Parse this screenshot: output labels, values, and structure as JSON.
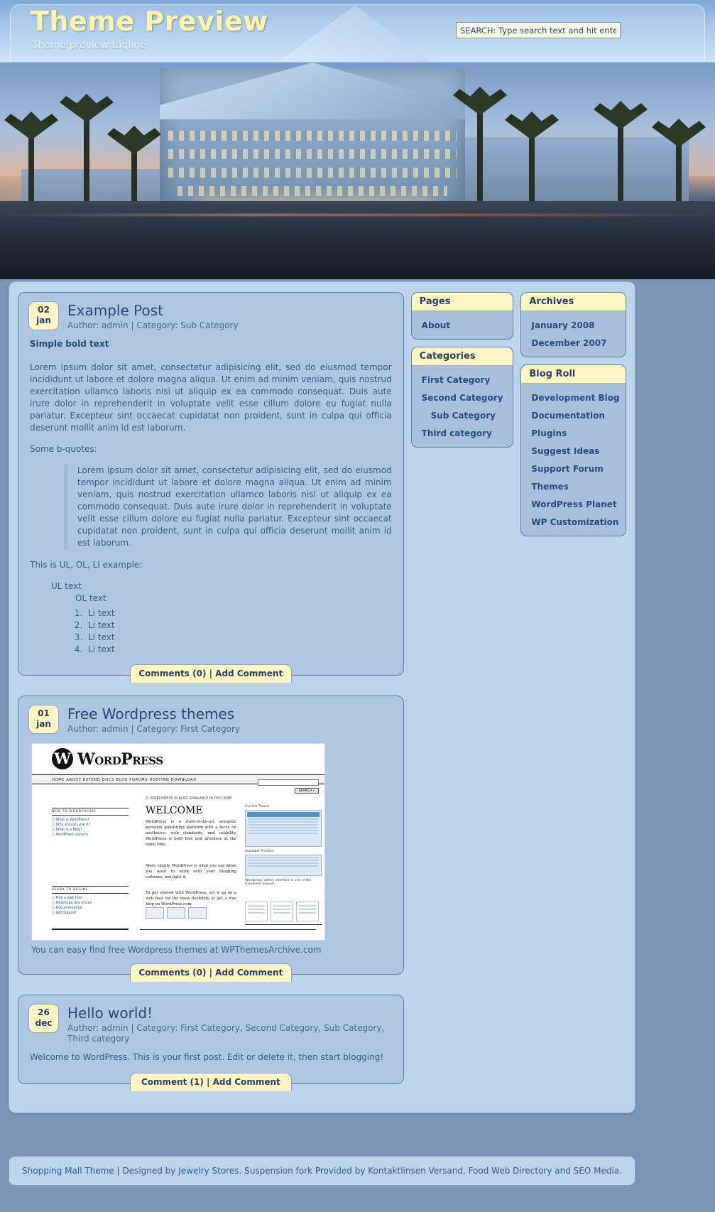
{
  "header": {
    "blog_title": "Theme Preview",
    "tagline": "Theme preview tagline",
    "search_value": "SEARCH: Type search text and hit enter!",
    "search_placeholder": "SEARCH: Type search text and hit enter!"
  },
  "posts": [
    {
      "day": "02",
      "month": "jan",
      "title": "Example Post",
      "meta": "Author: admin  |  Category: Sub Category",
      "lead": "Simple bold text",
      "para1": "Lorem ipsum dolor sit amet, consectetur adipisicing elit, sed do eiusmod tempor incididunt ut labore et dolore magna aliqua. Ut enim ad minim veniam, quis nostrud exercitation ullamco laboris nisi ut aliquip ex ea commodo consequat. Duis aute irure dolor in reprehenderit in voluptate velit esse cillum dolore eu fugiat nulla pariatur. Excepteur sint occaecat cupidatat non proident, sunt in culpa qui officia deserunt mollit anim id est laborum.",
      "quote_intro": "Some b-quotes:",
      "quote": "Lorem ipsum dolor sit amet, consectetur adipisicing elit, sed do eiusmod tempor incididunt ut labore et dolore magna aliqua. Ut enim ad minim veniam, quis nostrud exercitation ullamco laboris nisi ut aliquip ex ea commodo consequat. Duis aute irure dolor in reprehenderit in voluptate velit esse cillum dolore eu fugiat nulla pariatur. Excepteur sint occaecat cupidatat non proident, sunt in culpa qui officia deserunt mollit anim id est laborum.",
      "list_intro": "This is UL, OL, LI example:",
      "ul_text": "UL text",
      "ol_text": "OL text",
      "li_items": [
        "Li text",
        "Li text",
        "Li text",
        "Li text"
      ],
      "comment_bar": "Comments (0)  |  Add Comment"
    },
    {
      "day": "01",
      "month": "jan",
      "title": "Free Wordpress themes",
      "meta": "Author: admin  |  Category: First Category",
      "caption": "You can easy find free Wordpress themes at WPThemesArchive.com",
      "comment_bar": "Comments (0)  |  Add Comment",
      "screenshot": {
        "logo_letter": "W",
        "wordmark": "WordPress",
        "nav": "HOME     ABOUT     EXTEND     DOCS     BLOG     FORUMS     HOSTING     DOWNLOAD",
        "search_button": "SEARCH »",
        "ru_notice": "© WORDPRESS IS ALSO AVAILABLE IN РУССКИЙ.",
        "welcome": "WELCOME",
        "left_head_1": "NEW TO WORDPRESS?",
        "left_links_1": [
          "○ What is WordPress?",
          "○ Why should I use it?",
          "○ What is a blog?",
          "○ WordPress Lessons"
        ],
        "left_head_2": "READY TO BEGIN?",
        "left_links_2": [
          "○ Find a web host",
          "○ Download and Install",
          "○ Documentation",
          "○ Get Support"
        ],
        "para_1": "WordPress is a state-of-the-art semantic personal publishing platform with a focus on aesthetics, web standards, and usability. WordPress is both free and priceless at the same time.",
        "para_2": "More simply, WordPress is what you use when you want to work with your blogging software, not fight it.",
        "para_3": "To get started with WordPress, set it up on a web host for the most flexibility or get a free blog on WordPress.com.",
        "right_head": "Current Theme",
        "right_sub": "Available Themes",
        "right_caption": "Wordpress' admin interface is one of the friendliest around."
      }
    },
    {
      "day": "26",
      "month": "dec",
      "title": "Hello world!",
      "meta": "Author: admin  |  Category: First Category, Second Category, Sub Category, Third category",
      "body": "Welcome to WordPress. This is your first post. Edit or delete it, then start blogging!",
      "comment_bar": "Comment (1)  |  Add Comment"
    }
  ],
  "sidebar_left": [
    {
      "title": "Pages",
      "items": [
        {
          "label": "About",
          "indent": false
        }
      ]
    },
    {
      "title": "Categories",
      "items": [
        {
          "label": "First Category",
          "indent": false
        },
        {
          "label": "Second Category",
          "indent": false
        },
        {
          "label": "Sub Category",
          "indent": true
        },
        {
          "label": "Third category",
          "indent": false
        }
      ]
    }
  ],
  "sidebar_right": [
    {
      "title": "Archives",
      "items": [
        {
          "label": "January 2008",
          "indent": false
        },
        {
          "label": "December 2007",
          "indent": false
        }
      ]
    },
    {
      "title": "Blog Roll",
      "items": [
        {
          "label": "Development Blog",
          "indent": false
        },
        {
          "label": "Documentation",
          "indent": false
        },
        {
          "label": "Plugins",
          "indent": false
        },
        {
          "label": "Suggest Ideas",
          "indent": false
        },
        {
          "label": "Support Forum",
          "indent": false
        },
        {
          "label": "Themes",
          "indent": false
        },
        {
          "label": "WordPress Planet",
          "indent": false
        },
        {
          "label": "WP Customization",
          "indent": false
        }
      ]
    }
  ],
  "footer": {
    "parts": [
      {
        "text": "Shopping Mall Theme",
        "link": true
      },
      {
        "text": " | Designed by ",
        "link": false
      },
      {
        "text": "Jewelry Stores",
        "link": true
      },
      {
        "text": ". Suspension fork ",
        "link": false
      },
      {
        "text": "Provided by",
        "link": true
      },
      {
        "text": " Kontaktlinsen Versand, Food Web Directory ",
        "link": false
      },
      {
        "text": "and",
        "link": true
      },
      {
        "text": " SEO Media.",
        "link": false
      }
    ]
  },
  "colors": {
    "accent_yellow": "#fdf6c4",
    "title_yellow": "#fdf4a8",
    "post_bg": "#aec6e0",
    "wrap_bg": "#bcd3ea",
    "link_blue": "#2c4b7d"
  }
}
